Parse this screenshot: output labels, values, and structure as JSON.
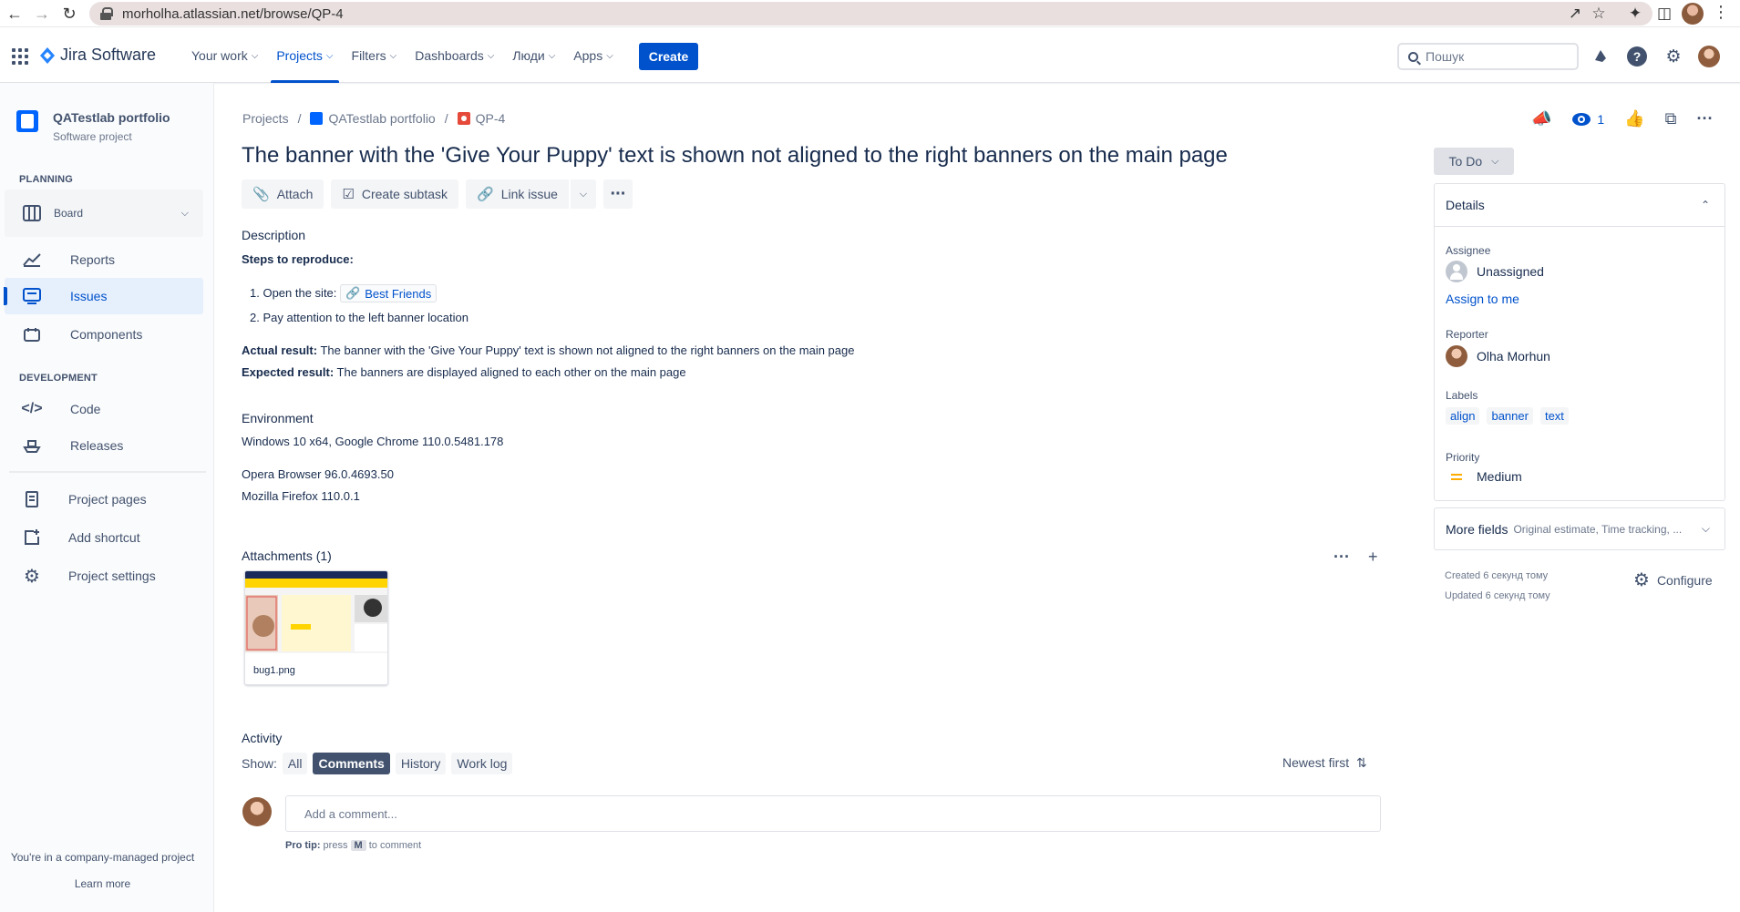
{
  "browser": {
    "url": "morholha.atlassian.net/browse/QP-4"
  },
  "topnav": {
    "product": "Jira Software",
    "items": [
      {
        "label": "Your work"
      },
      {
        "label": "Projects"
      },
      {
        "label": "Filters"
      },
      {
        "label": "Dashboards"
      },
      {
        "label": "Люди"
      },
      {
        "label": "Apps"
      }
    ],
    "create_label": "Create",
    "search_placeholder": "Пошук",
    "accent": "#0052CC"
  },
  "sidebar": {
    "project_name": "QATestlab portfolio",
    "project_type": "Software project",
    "planning_title": "PLANNING",
    "board_label": "Board",
    "reports_label": "Reports",
    "issues_label": "Issues",
    "components_label": "Components",
    "development_title": "DEVELOPMENT",
    "code_label": "Code",
    "releases_label": "Releases",
    "project_pages_label": "Project pages",
    "add_shortcut_label": "Add shortcut",
    "project_settings_label": "Project settings",
    "footer_text": "You're in a company-managed project",
    "learn_more": "Learn more"
  },
  "breadcrumb": {
    "projects": "Projects",
    "project": "QATestlab portfolio",
    "issue_key": "QP-4"
  },
  "issue": {
    "title": "The banner with the 'Give Your Puppy' text is shown not aligned to the right banners on the main page",
    "actions": {
      "attach": "Attach",
      "create_subtask": "Create subtask",
      "link_issue": "Link issue"
    },
    "description_heading": "Description",
    "steps_label": "Steps to reproduce:",
    "step1_prefix": "1. Open the site:",
    "step1_link": "Best Friends",
    "step2": "2. Pay attention to the left banner location",
    "actual_label": "Actual result:",
    "actual_text": " The banner with the 'Give Your Puppy' text is shown not aligned to the right banners on the main page",
    "expected_label": "Expected result:",
    "expected_text": " The banners are displayed aligned to each other on the main page",
    "environment_heading": "Environment",
    "env_line1": "Windows 10 x64, Google Chrome 110.0.5481.178",
    "env_line2": "Opera Browser 96.0.4693.50",
    "env_line3": "Mozilla Firefox 110.0.1",
    "attachments_heading": "Attachments (1)",
    "attachment_name": "bug1.png",
    "activity_heading": "Activity",
    "show_label": "Show:",
    "filters": [
      "All",
      "Comments",
      "History",
      "Work log"
    ],
    "active_filter": "Comments",
    "sort_label": "Newest first",
    "comment_placeholder": "Add a comment...",
    "protip_label": "Pro tip:",
    "protip_press": " press ",
    "protip_key": "M",
    "protip_rest": " to comment"
  },
  "right": {
    "watchers_count": "1",
    "status": "To Do",
    "details_heading": "Details",
    "assignee_label": "Assignee",
    "assignee_value": "Unassigned",
    "assign_to_me": "Assign to me",
    "reporter_label": "Reporter",
    "reporter_value": "Olha Morhun",
    "labels_label": "Labels",
    "labels": [
      "align",
      "banner",
      "text"
    ],
    "priority_label": "Priority",
    "priority_value": "Medium",
    "more_fields": "More fields",
    "more_fields_sub": "Original estimate, Time tracking, ...",
    "created": "Created 6 секунд тому",
    "updated": "Updated 6 секунд тому",
    "configure": "Configure"
  }
}
